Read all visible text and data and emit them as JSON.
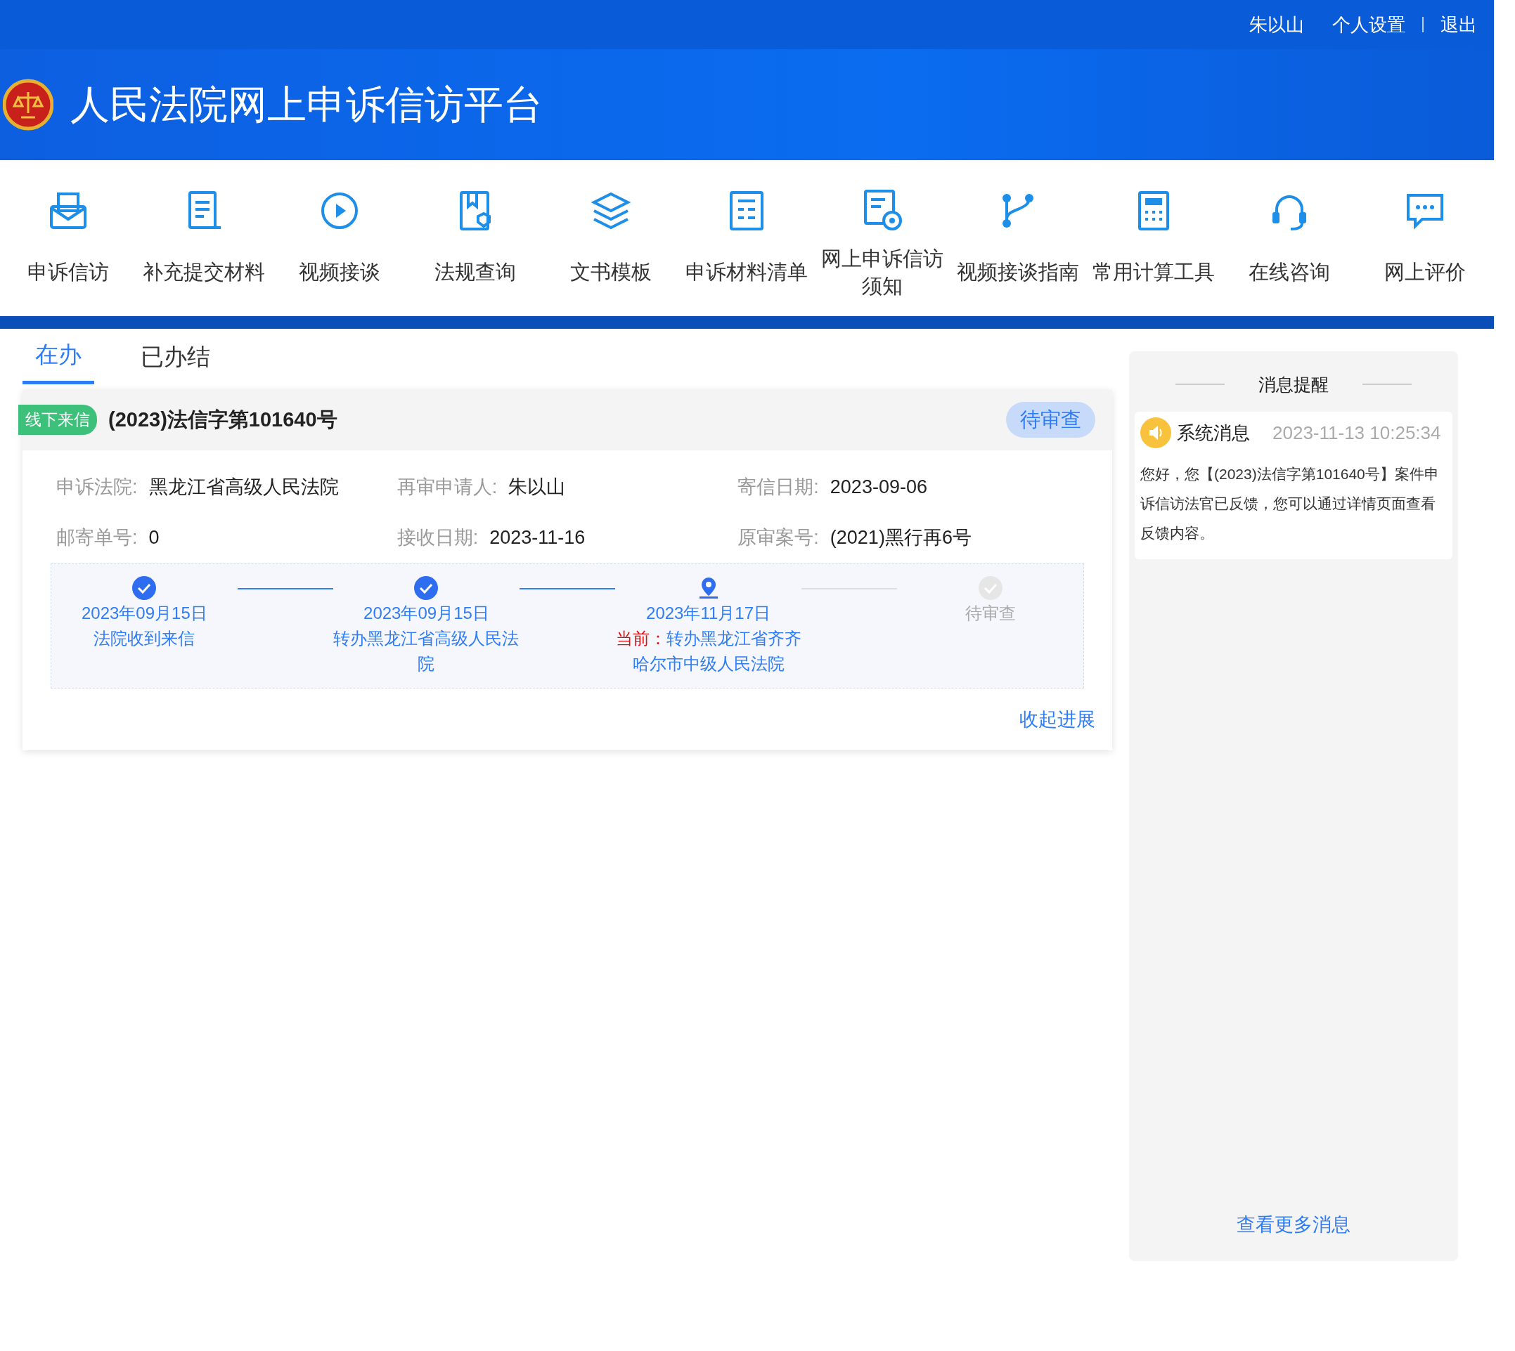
{
  "top_bar": {
    "user": "朱以山",
    "links": [
      "个人设置",
      "退出"
    ]
  },
  "banner": {
    "title": "人民法院网上申诉信访平台"
  },
  "nav": [
    {
      "label": "申诉信访"
    },
    {
      "label": "补充提交材料"
    },
    {
      "label": "视频接谈"
    },
    {
      "label": "法规查询"
    },
    {
      "label": "文书模板"
    },
    {
      "label": "申诉材料清单"
    },
    {
      "label": "网上申诉信访须知"
    },
    {
      "label": "视频接谈指南"
    },
    {
      "label": "常用计算工具"
    },
    {
      "label": "在线咨询"
    },
    {
      "label": "网上评价"
    }
  ],
  "tabs": [
    {
      "label": "在办",
      "selected": true
    },
    {
      "label": "已办结",
      "selected": false
    }
  ],
  "case": {
    "tag": "线下来信",
    "title": "(2023)法信字第101640号",
    "status": "待审查",
    "fields": [
      {
        "label": "申诉法院:",
        "value": "黑龙江省高级人民法院"
      },
      {
        "label": "再审申请人:",
        "value": "朱以山"
      },
      {
        "label": "寄信日期:",
        "value": "2023-09-06"
      },
      {
        "label": "邮寄单号:",
        "value": "0"
      },
      {
        "label": "接收日期:",
        "value": "2023-11-16"
      },
      {
        "label": "原审案号:",
        "value": "(2021)黑行再6号"
      }
    ],
    "steps": [
      {
        "kind": "done",
        "date": "2023年09月15日",
        "text": "法院收到来信"
      },
      {
        "kind": "done",
        "date": "2023年09月15日",
        "text": "转办黑龙江省高级人民法院"
      },
      {
        "kind": "current",
        "date": "2023年11月17日",
        "prefix": "当前：",
        "text": "转办黑龙江省齐齐哈尔市中级人民法院"
      },
      {
        "kind": "pending",
        "text": "待审查"
      }
    ],
    "collapse_link": "收起进展"
  },
  "messages": {
    "title": "消息提醒",
    "items": [
      {
        "source": "系统消息",
        "time": "2023-11-13 10:25:34",
        "body": "您好，您【(2023)法信字第101640号】案件申诉信访法官已反馈，您可以通过详情页面查看反馈内容。"
      }
    ],
    "more_link": "查看更多消息"
  }
}
